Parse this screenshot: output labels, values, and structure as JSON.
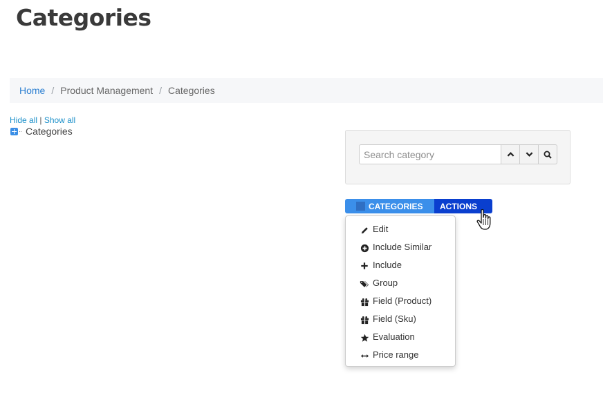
{
  "page": {
    "title": "Categories"
  },
  "breadcrumb": {
    "items": [
      {
        "label": "Home",
        "link": true
      },
      {
        "label": "Product Management",
        "link": false
      },
      {
        "label": "Categories",
        "link": false
      }
    ],
    "separator": "/"
  },
  "tree": {
    "hide_all": "Hide all",
    "divider": "|",
    "show_all": "Show all",
    "root_label": "Categories"
  },
  "search": {
    "placeholder": "Search category",
    "value": ""
  },
  "toolbar": {
    "categories_label": "CATEGORIES",
    "actions_label": "ACTIONS"
  },
  "actions_menu": {
    "items": [
      {
        "label": "Edit",
        "icon": "pencil-icon"
      },
      {
        "label": "Include Similar",
        "icon": "plus-circle-icon"
      },
      {
        "label": "Include",
        "icon": "plus-icon"
      },
      {
        "label": "Group",
        "icon": "tags-icon"
      },
      {
        "label": "Field (Product)",
        "icon": "gift-icon"
      },
      {
        "label": "Field (Sku)",
        "icon": "gift-icon"
      },
      {
        "label": "Evaluation",
        "icon": "star-icon"
      },
      {
        "label": "Price range",
        "icon": "arrows-horizontal-icon"
      }
    ]
  },
  "colors": {
    "categories_button": "#3b8fea",
    "actions_button": "#0a3fcf",
    "link": "#2c7fd1"
  }
}
